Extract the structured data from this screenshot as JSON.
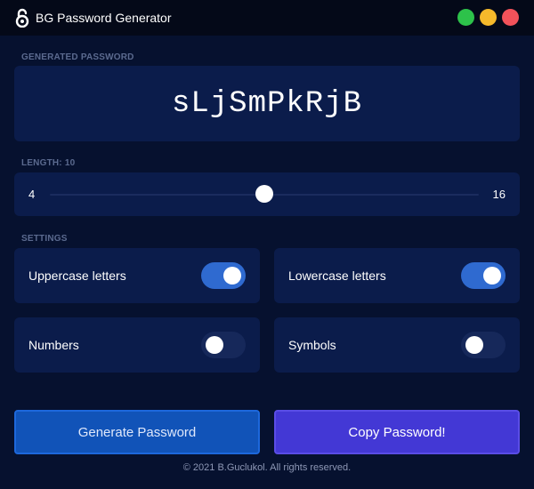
{
  "window": {
    "title": "BG Password Generator",
    "icon": "padlock-icon",
    "controls": [
      "maximize",
      "minimize",
      "close"
    ]
  },
  "password": {
    "section_label": "GENERATED PASSWORD",
    "value": "sLjSmPkRjB"
  },
  "length": {
    "section_label": "LENGTH: 10",
    "min": 4,
    "max": 16,
    "value": 10,
    "min_label": "4",
    "max_label": "16"
  },
  "settings": {
    "section_label": "SETTINGS",
    "options": [
      {
        "label": "Uppercase letters",
        "enabled": true
      },
      {
        "label": "Lowercase letters",
        "enabled": true
      },
      {
        "label": "Numbers",
        "enabled": false
      },
      {
        "label": "Symbols",
        "enabled": false
      }
    ]
  },
  "actions": {
    "generate_label": "Generate Password",
    "copy_label": "Copy Password!"
  },
  "footer": {
    "text": "© 2021 B.Guclukol. All rights reserved."
  },
  "colors": {
    "background": "#06112f",
    "card": "#0b1c4b",
    "toggle_on": "#2f6ad0",
    "generate_button": "#1153b8",
    "copy_button": "#4338d5"
  }
}
